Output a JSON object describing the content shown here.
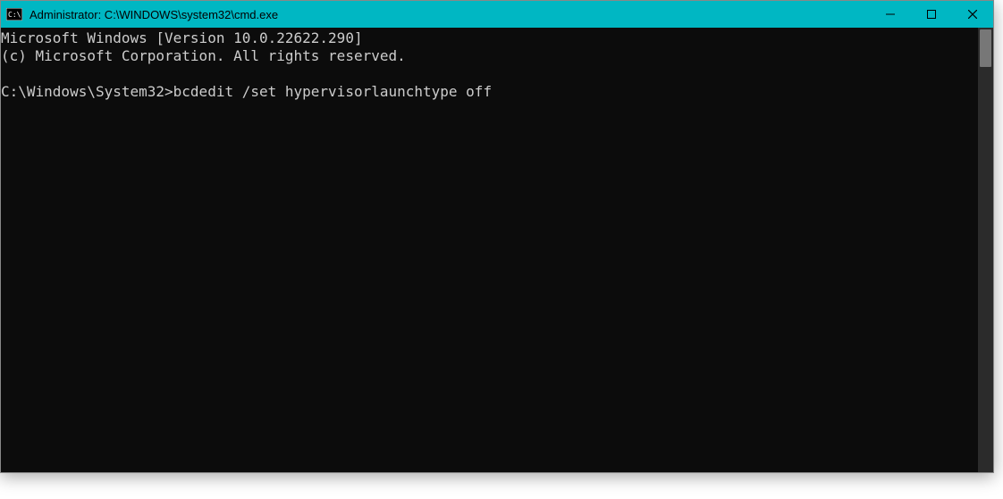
{
  "titlebar": {
    "title": "Administrator: C:\\WINDOWS\\system32\\cmd.exe"
  },
  "console": {
    "line1": "Microsoft Windows [Version 10.0.22622.290]",
    "line2": "(c) Microsoft Corporation. All rights reserved.",
    "blank": "",
    "prompt": "C:\\Windows\\System32>",
    "command": "bcdedit /set hypervisorlaunchtype off"
  }
}
